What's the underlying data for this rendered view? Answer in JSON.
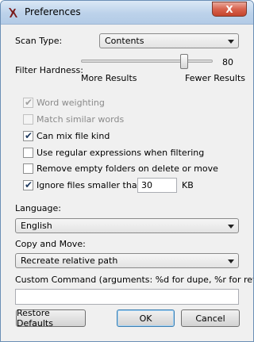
{
  "window": {
    "title": "Preferences",
    "close_symbol": "X"
  },
  "scan_type": {
    "label": "Scan Type:",
    "value": "Contents"
  },
  "filter_hardness": {
    "label": "Filter Hardness:",
    "value": 80,
    "value_text": "80",
    "min_label": "More Results",
    "max_label": "Fewer Results"
  },
  "options": [
    {
      "label": "Word weighting",
      "checked": true,
      "enabled": false
    },
    {
      "label": "Match similar words",
      "checked": false,
      "enabled": false
    },
    {
      "label": "Can mix file kind",
      "checked": true,
      "enabled": true
    },
    {
      "label": "Use regular expressions when filtering",
      "checked": false,
      "enabled": true
    },
    {
      "label": "Remove empty folders on delete or move",
      "checked": false,
      "enabled": true
    }
  ],
  "ignore_small": {
    "label": "Ignore files smaller than",
    "checked": true,
    "size_value": "30",
    "unit": "KB"
  },
  "language": {
    "label": "Language:",
    "value": "English"
  },
  "copy_move": {
    "label": "Copy and Move:",
    "value": "Recreate relative path"
  },
  "custom_command": {
    "label": "Custom Command (arguments: %d for dupe, %r for ref):",
    "value": ""
  },
  "buttons": {
    "restore": "Restore Defaults",
    "ok": "OK",
    "cancel": "Cancel"
  }
}
